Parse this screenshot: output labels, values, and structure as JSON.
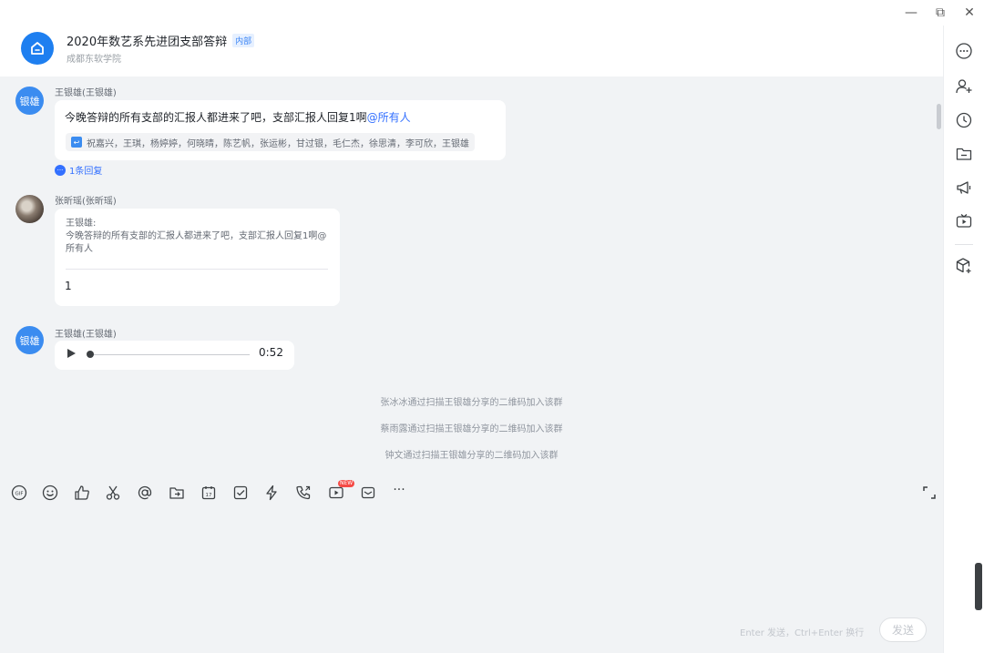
{
  "window": {
    "minimize": "—",
    "restore": "⧉",
    "close": "✕"
  },
  "header": {
    "title": "2020年数艺系先进团支部答辩",
    "tag": "内部",
    "subtitle": "成都东软学院"
  },
  "messages": [
    {
      "sender": "王银雄(王银雄)",
      "avatar_text": "银雄",
      "text": "今晚答辩的所有支部的汇报人都进来了吧，支部汇报人回复1啊",
      "mention": "@所有人",
      "read_by": "祝嘉兴，王琪，杨婷婷，何晓晴，陈艺帆，张运彬，甘过银，毛仁杰，徐思清，李可欣，王银雄",
      "reply_link": "1条回复"
    },
    {
      "sender": "张昕瑶(张昕瑶)",
      "quote_author": "王银雄:",
      "quote_text": "今晚答辩的所有支部的汇报人都进来了吧，支部汇报人回复1啊@所有人",
      "text": "1"
    },
    {
      "sender": "王银雄(王银雄)",
      "avatar_text": "银雄",
      "voice_duration": "0:52",
      "voice_progress": 0
    }
  ],
  "system_messages": [
    "张冰冰通过扫描王银雄分享的二维码加入该群",
    "蔡雨露通过扫描王银雄分享的二维码加入该群",
    "钟文通过扫描王银雄分享的二维码加入该群"
  ],
  "toolbar": {
    "new_badge": "NEW",
    "more": "···"
  },
  "input": {
    "value": "",
    "hint": "Enter 发送，Ctrl+Enter 换行",
    "send_label": "发送"
  }
}
